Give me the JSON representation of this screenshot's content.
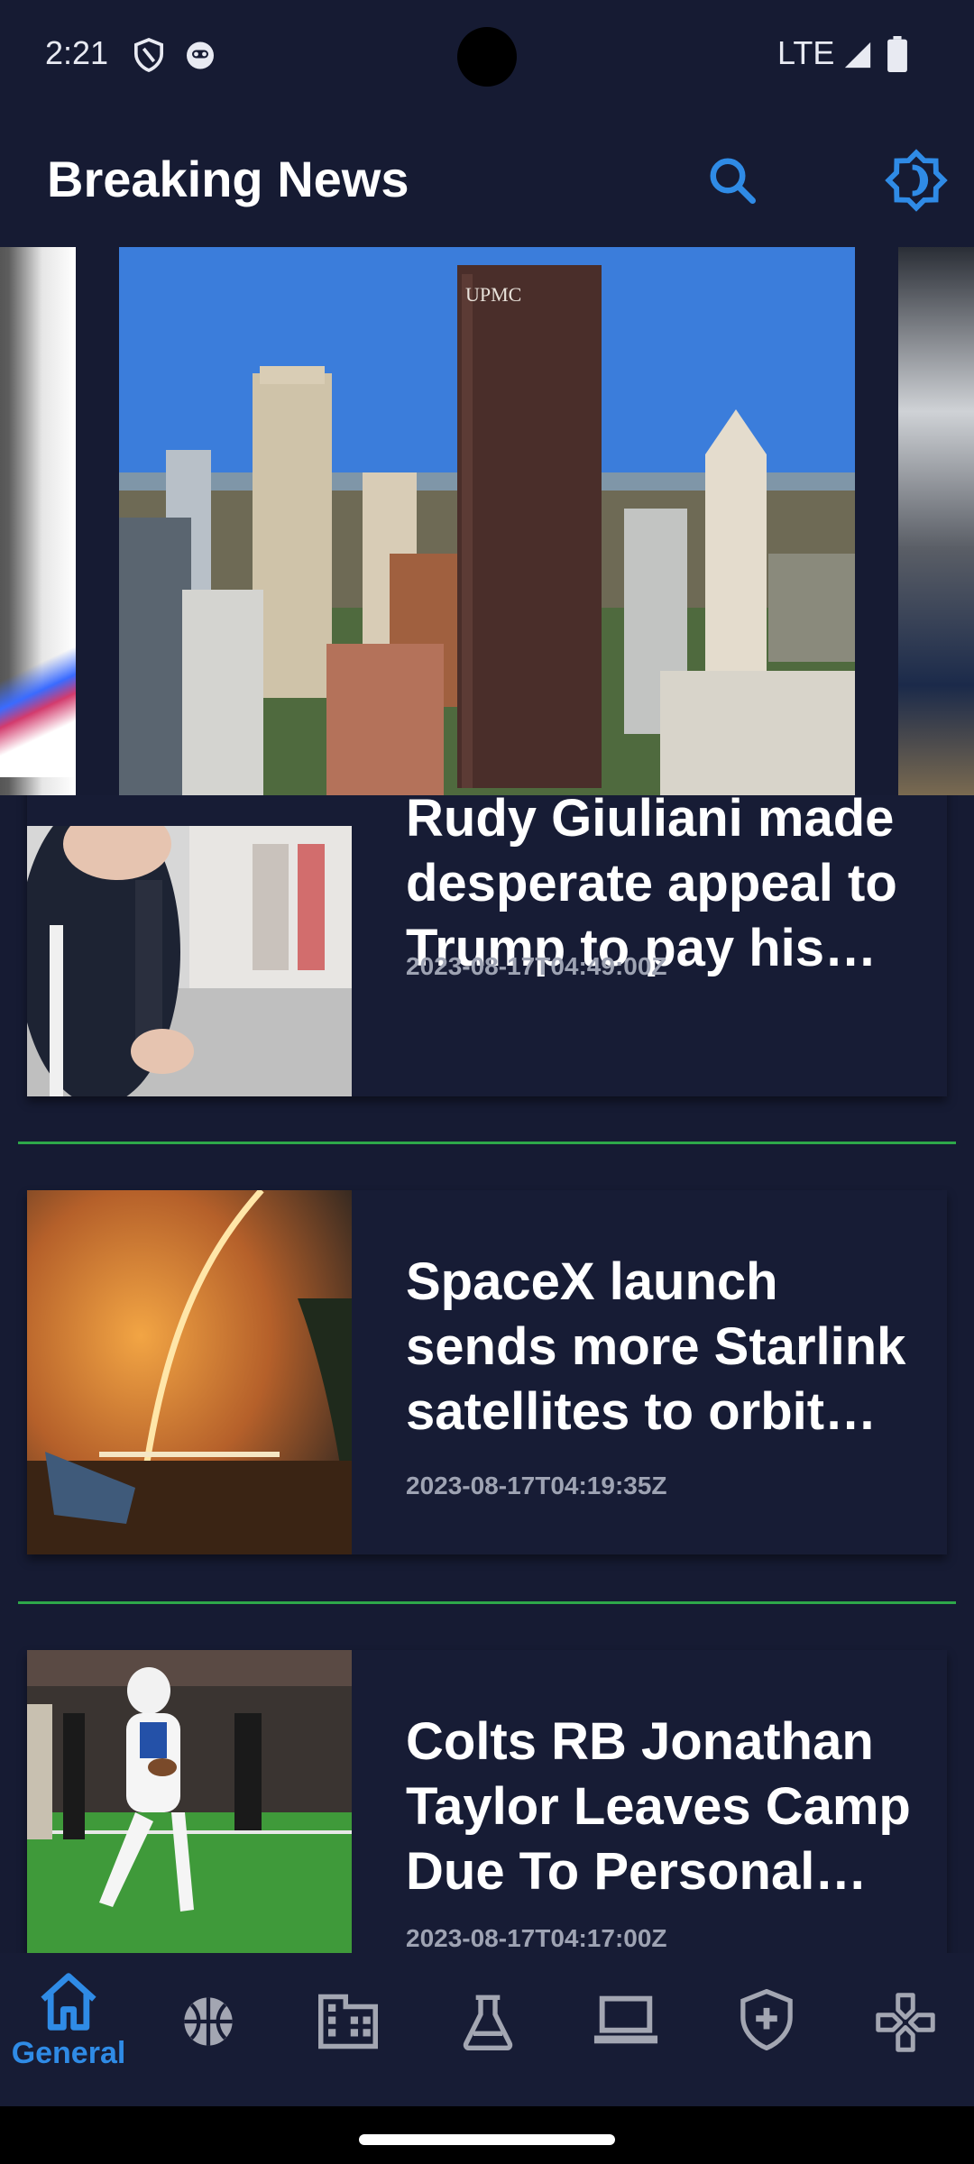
{
  "status_bar": {
    "time": "2:21",
    "network": "LTE",
    "icons": [
      "shield-icon",
      "face-icon",
      "signal-icon",
      "battery-icon"
    ]
  },
  "header": {
    "title": "Breaking News",
    "search_icon": "search-icon",
    "theme_icon": "brightness-icon",
    "accent_color": "#2f8be6"
  },
  "carousel": {
    "slides": [
      "previous-slide",
      "city-skyline-image",
      "next-slide"
    ],
    "main_image_sign": "UPMC"
  },
  "articles": [
    {
      "title": "Rudy Giuliani made desperate appeal to Trump to pay his leg…",
      "date": "2023-08-17T04:49:00Z"
    },
    {
      "title": "SpaceX launch sends more Starlink satellites to orbit lat…",
      "date": "2023-08-17T04:19:35Z"
    },
    {
      "title": "Colts RB Jonathan Taylor Leaves Camp Due To Personal Ma…",
      "date": "2023-08-17T04:17:00Z"
    }
  ],
  "divider_color": "#2ea84a",
  "bottom_nav": {
    "selected": "General",
    "items": [
      {
        "label": "General",
        "icon": "home-icon"
      },
      {
        "label": "",
        "icon": "basketball-icon"
      },
      {
        "label": "",
        "icon": "business-icon"
      },
      {
        "label": "",
        "icon": "science-icon"
      },
      {
        "label": "",
        "icon": "laptop-icon"
      },
      {
        "label": "",
        "icon": "health-icon"
      },
      {
        "label": "",
        "icon": "gamepad-icon"
      }
    ]
  }
}
